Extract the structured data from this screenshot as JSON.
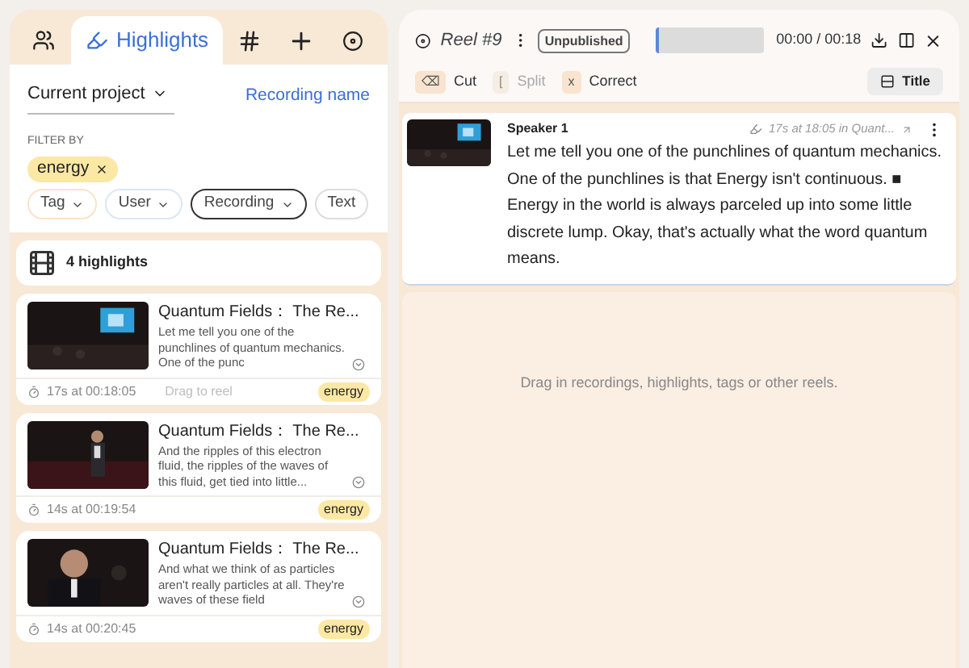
{
  "tabs": [
    {
      "kind": "people",
      "selected": false
    },
    {
      "kind": "highlights",
      "label": "Highlights",
      "selected": true
    },
    {
      "kind": "hash",
      "selected": false
    },
    {
      "kind": "plus",
      "selected": false
    },
    {
      "kind": "reel",
      "selected": false
    }
  ],
  "scope": {
    "value": "Current project"
  },
  "sort_link": "Recording name",
  "filter": {
    "label": "FILTER BY",
    "active": [
      {
        "label": "energy"
      }
    ],
    "options": [
      {
        "label": "Tag",
        "color": "#fbe3c6"
      },
      {
        "label": "User",
        "color": "#dbe7f3"
      },
      {
        "label": "Recording",
        "color": "#333333"
      },
      {
        "label": "Text",
        "color": "#dddddd"
      }
    ]
  },
  "summary": "4 highlights",
  "highlights": [
    {
      "title": "Quantum Fields：  The Re...",
      "text": "Let me tell you one of the punchlines of quantum mechanics. One of the punc",
      "time": "17s at 00:18:05",
      "tag": "energy",
      "hint": "Drag to reel"
    },
    {
      "title": "Quantum Fields：  The Re...",
      "text": "And the ripples of this electron fluid, the ripples of the waves of this fluid, get tied into little...",
      "time": "14s at 00:19:54",
      "tag": "energy"
    },
    {
      "title": "Quantum Fields：  The Re...",
      "text": "And what we think of as particles aren't really particles at all. They're waves of these field",
      "time": "14s at 00:20:45",
      "tag": "energy"
    }
  ],
  "reel": {
    "title": "Reel #9",
    "status": "Unpublished",
    "time": "00:00 / 00:18"
  },
  "tools": [
    {
      "key": "⌫",
      "label": "Cut",
      "disabled": false
    },
    {
      "key": "[",
      "label": "Split",
      "disabled": true
    },
    {
      "key": "x",
      "label": "Correct",
      "disabled": false
    }
  ],
  "title_button": "Title",
  "clip": {
    "speaker": "Speaker 1",
    "source": "17s at 18:05 in Quant...",
    "text": "Let me tell you one of the punchlines of quantum mechanics. One of the punchlines is that Energy isn't continuous. ■ Energy in the world is always parceled up into some little discrete lump. Okay, that's actually what the word quantum means."
  },
  "dropzone": "Drag in recordings, highlights, tags or other reels."
}
